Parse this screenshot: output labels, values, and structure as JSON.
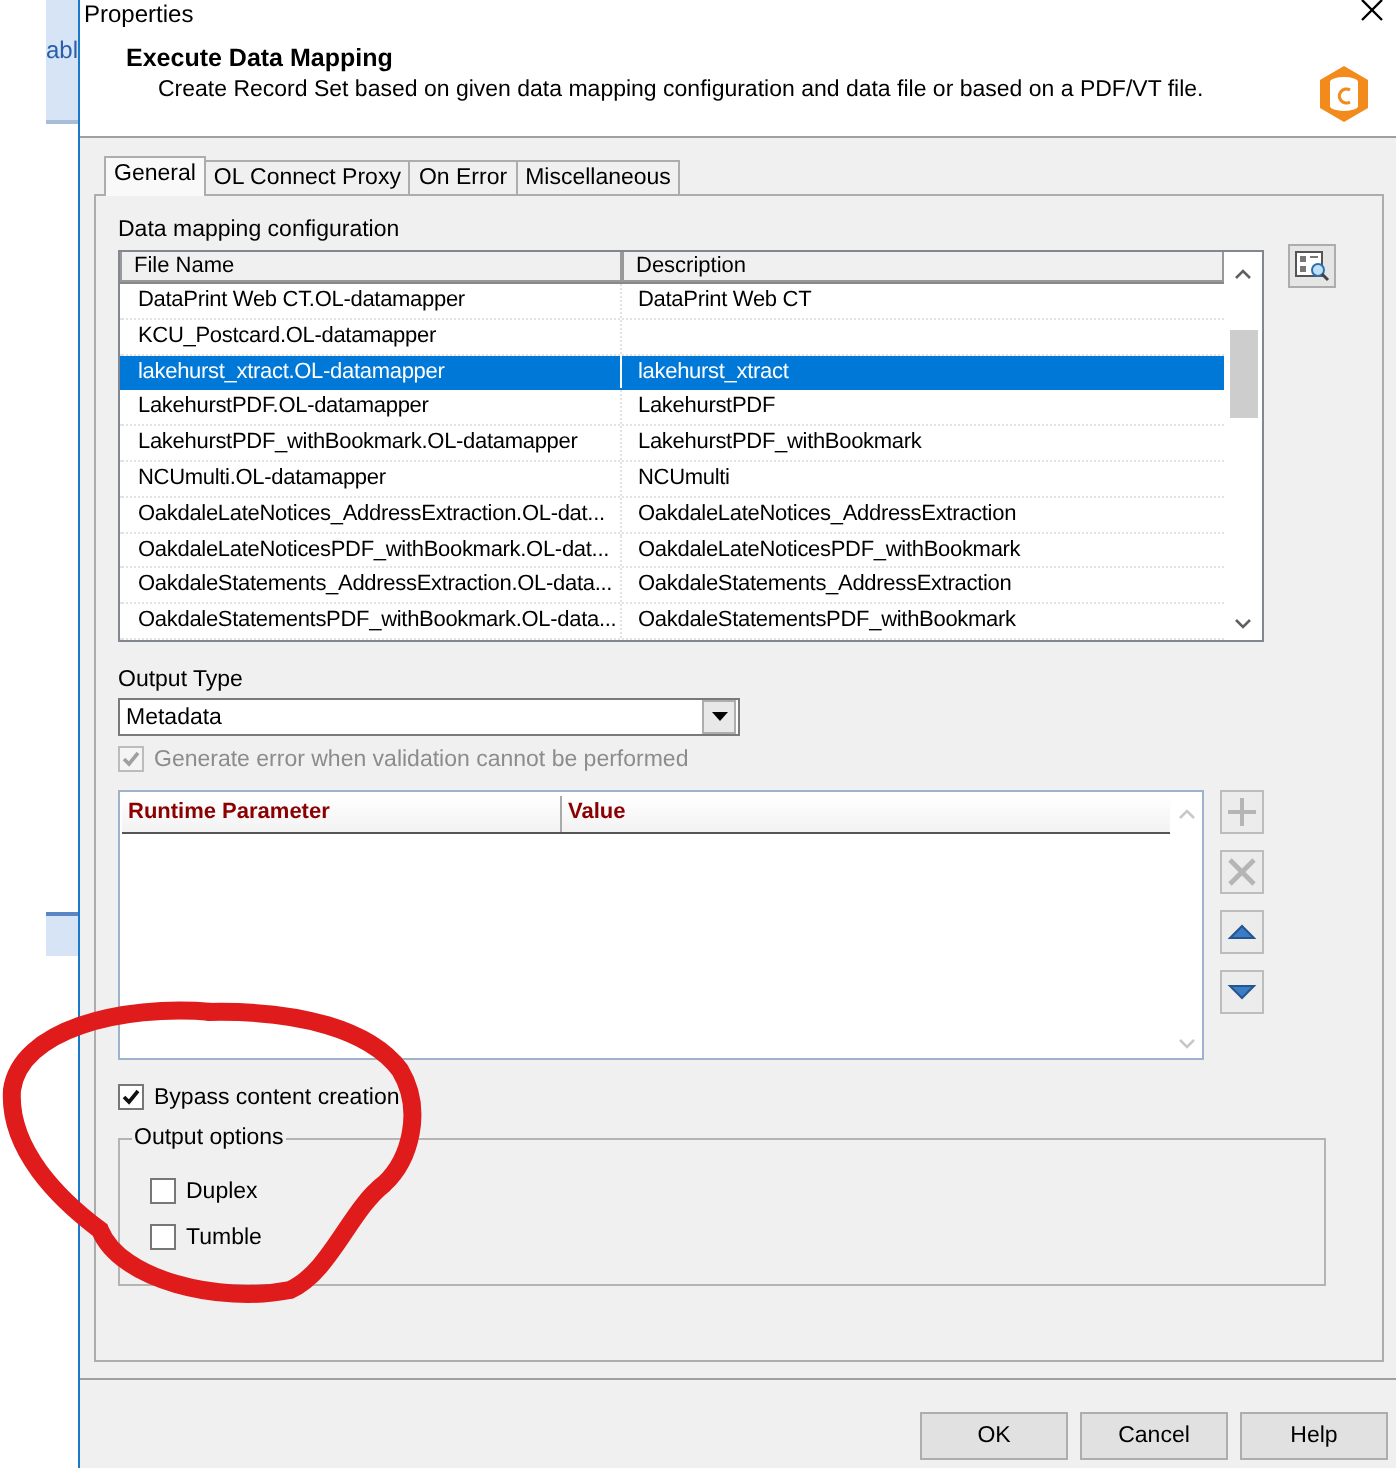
{
  "background_window": {
    "text": "abl"
  },
  "window": {
    "title": "Properties"
  },
  "header": {
    "title": "Execute Data Mapping",
    "subtitle": "Create Record Set based on given data mapping configuration and data file or based on a PDF/VT file."
  },
  "tabs": [
    {
      "label": "General",
      "selected": true
    },
    {
      "label": "OL Connect Proxy",
      "selected": false
    },
    {
      "label": "On Error",
      "selected": false
    },
    {
      "label": "Miscellaneous",
      "selected": false
    }
  ],
  "data_mapping": {
    "label": "Data mapping configuration",
    "columns": [
      "File Name",
      "Description"
    ],
    "rows": [
      {
        "file_name": "DataPrint Web CT.OL-datamapper",
        "description": "DataPrint Web CT",
        "selected": false
      },
      {
        "file_name": "KCU_Postcard.OL-datamapper",
        "description": "",
        "selected": false
      },
      {
        "file_name": "lakehurst_xtract.OL-datamapper",
        "description": "lakehurst_xtract",
        "selected": true
      },
      {
        "file_name": "LakehurstPDF.OL-datamapper",
        "description": "LakehurstPDF",
        "selected": false
      },
      {
        "file_name": "LakehurstPDF_withBookmark.OL-datamapper",
        "description": "LakehurstPDF_withBookmark",
        "selected": false
      },
      {
        "file_name": "NCUmulti.OL-datamapper",
        "description": "NCUmulti",
        "selected": false
      },
      {
        "file_name": "OakdaleLateNotices_AddressExtraction.OL-dat...",
        "description": "OakdaleLateNotices_AddressExtraction",
        "selected": false
      },
      {
        "file_name": "OakdaleLateNoticesPDF_withBookmark.OL-dat...",
        "description": "OakdaleLateNoticesPDF_withBookmark",
        "selected": false
      },
      {
        "file_name": "OakdaleStatements_AddressExtraction.OL-data...",
        "description": "OakdaleStatements_AddressExtraction",
        "selected": false
      },
      {
        "file_name": "OakdaleStatementsPDF_withBookmark.OL-data...",
        "description": "OakdaleStatementsPDF_withBookmark",
        "selected": false
      }
    ]
  },
  "output_type": {
    "label": "Output Type",
    "value": "Metadata"
  },
  "generate_error": {
    "label": "Generate error when validation cannot be performed",
    "checked": true,
    "disabled": true
  },
  "runtime_parameters": {
    "columns": [
      "Runtime Parameter",
      "Value"
    ]
  },
  "bypass_content_creation": {
    "label": "Bypass content creation",
    "checked": true,
    "disabled": false
  },
  "output_options": {
    "title": "Output options",
    "options": [
      {
        "label": "Duplex",
        "checked": false
      },
      {
        "label": "Tumble",
        "checked": false
      }
    ]
  },
  "buttons": [
    {
      "label": "OK"
    },
    {
      "label": "Cancel"
    },
    {
      "label": "Help"
    }
  ]
}
